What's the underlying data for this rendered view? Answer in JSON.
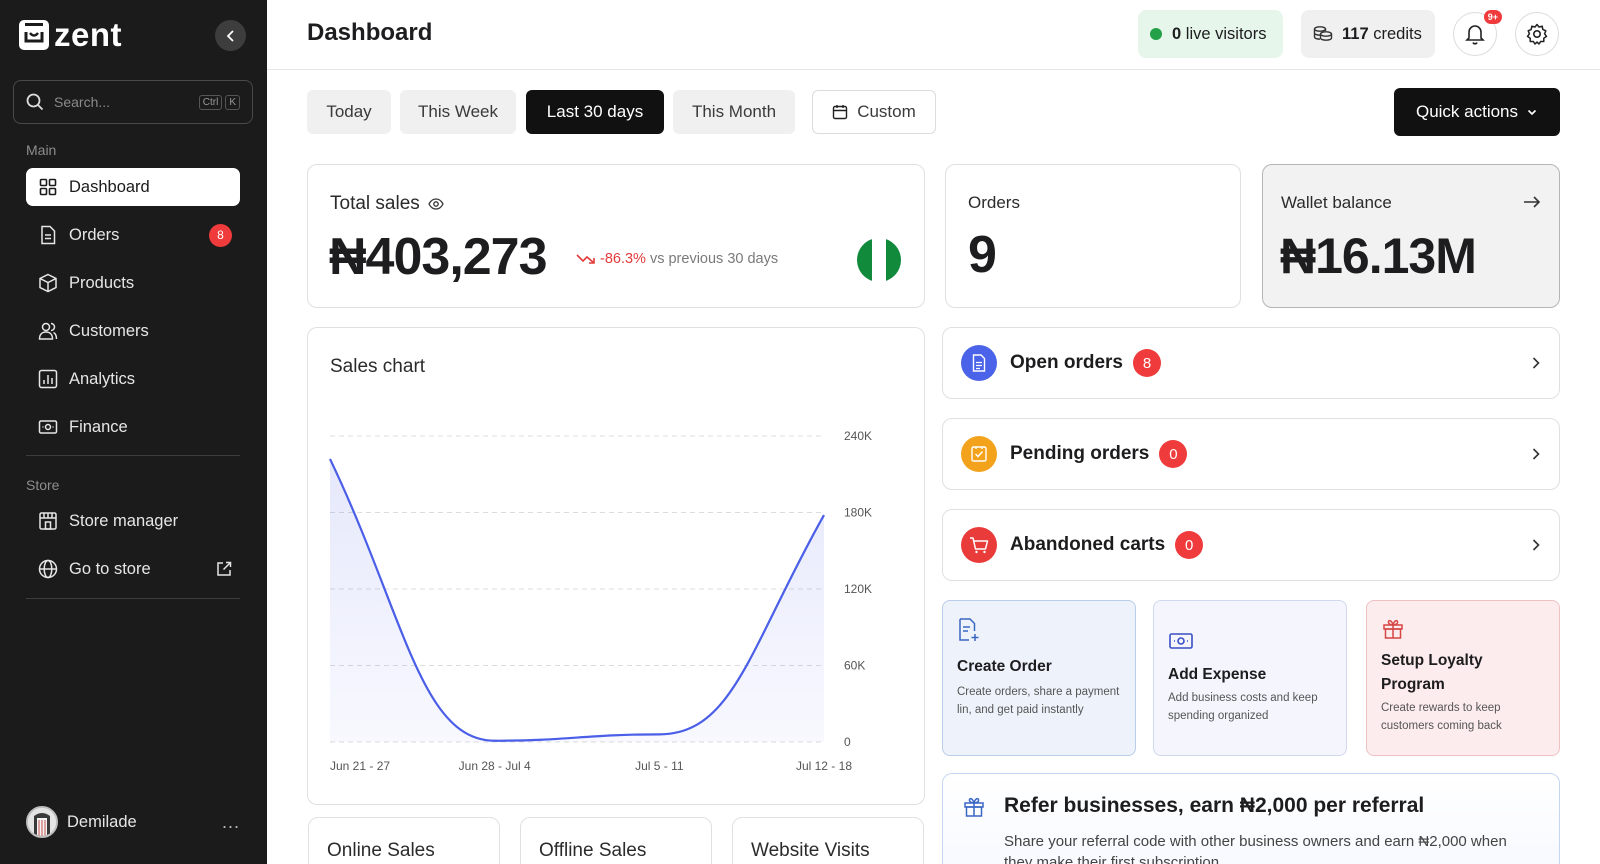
{
  "app": {
    "name": "zent"
  },
  "sidebar": {
    "search": {
      "placeholder": "Search...",
      "shortcut_ctrl": "Ctrl",
      "shortcut_key": "K"
    },
    "section_main": "Main",
    "section_store": "Store",
    "items": [
      {
        "label": "Dashboard",
        "icon": "grid-icon",
        "active": true
      },
      {
        "label": "Orders",
        "icon": "document-icon",
        "badge": "8"
      },
      {
        "label": "Products",
        "icon": "box-icon"
      },
      {
        "label": "Customers",
        "icon": "users-icon"
      },
      {
        "label": "Analytics",
        "icon": "bar-chart-icon"
      },
      {
        "label": "Finance",
        "icon": "banknote-icon"
      }
    ],
    "store_items": [
      {
        "label": "Store manager",
        "icon": "store-icon"
      },
      {
        "label": "Go to store",
        "icon": "globe-icon"
      }
    ],
    "user": {
      "name": "Demilade",
      "more": "..."
    }
  },
  "header": {
    "title": "Dashboard",
    "live_visitors_count": "0",
    "live_visitors_label": "live visitors",
    "credits_count": "117",
    "credits_label": "credits",
    "notifications_badge": "9+"
  },
  "filters": {
    "today": "Today",
    "this_week": "This Week",
    "last_30": "Last 30 days",
    "this_month": "This Month",
    "custom": "Custom",
    "active": "Last 30 days",
    "quick_actions": "Quick actions"
  },
  "total_sales": {
    "label": "Total sales",
    "value": "₦403,273",
    "change": "-86.3%",
    "compare": "vs previous 30 days"
  },
  "orders_card": {
    "label": "Orders",
    "value": "9"
  },
  "wallet": {
    "label": "Wallet balance",
    "value": "₦16.13M"
  },
  "sales_chart": {
    "title": "Sales chart"
  },
  "chart_data": {
    "type": "area",
    "title": "Sales chart",
    "x": [
      "Jun 21 - 27",
      "Jun 28 - Jul 4",
      "Jul 5 - 11",
      "Jul 12 - 18"
    ],
    "y_ticks": [
      "240K",
      "180K",
      "120K",
      "60K",
      "0"
    ],
    "ylim": [
      0,
      240000
    ],
    "series": [
      {
        "values": [
          222000,
          1000,
          6000,
          178000
        ]
      }
    ],
    "grid": true,
    "color": "#4a5ee8"
  },
  "order_rows": [
    {
      "label": "Open orders",
      "count": "8",
      "color": "#4a63e8",
      "icon": "document-icon"
    },
    {
      "label": "Pending orders",
      "count": "0",
      "color": "#f3a21c",
      "icon": "receipt-icon"
    },
    {
      "label": "Abandoned carts",
      "count": "0",
      "color": "#ea3b3b",
      "icon": "cart-icon"
    }
  ],
  "actions": [
    {
      "title": "Create Order",
      "desc": "Create orders, share a payment lin, and get paid instantly",
      "icon": "file-plus-icon"
    },
    {
      "title": "Add Expense",
      "desc": "Add business costs and keep spending organized",
      "icon": "banknote-icon"
    },
    {
      "title": "Setup Loyalty Program",
      "desc": "Create rewards to keep customers coming back",
      "icon": "gift-icon"
    }
  ],
  "refer": {
    "title": "Refer businesses, earn ₦2,000 per referral",
    "desc": "Share your referral code with other business owners and earn ₦2,000 when they make their first subscription"
  },
  "stats": [
    {
      "label": "Online Sales"
    },
    {
      "label": "Offline Sales"
    },
    {
      "label": "Website Visits"
    }
  ]
}
